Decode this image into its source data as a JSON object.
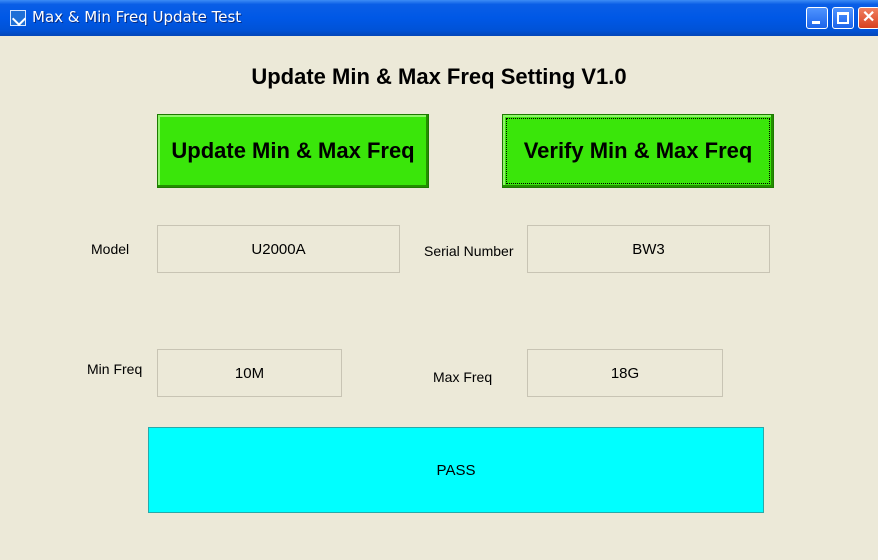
{
  "window": {
    "title": "Max & Min Freq Update Test"
  },
  "heading": "Update Min & Max Freq Setting  V1.0",
  "buttons": {
    "update": "Update Min & Max Freq",
    "verify": "Verify Min & Max Freq"
  },
  "fields": {
    "model": {
      "label": "Model",
      "value": "U2000A"
    },
    "serial": {
      "label": "Serial Number",
      "value": "BW3"
    },
    "min_freq": {
      "label": "Min Freq",
      "value": "10M"
    },
    "max_freq": {
      "label": "Max Freq",
      "value": "18G"
    }
  },
  "status": {
    "text": "PASS",
    "color": "#00ffff"
  }
}
